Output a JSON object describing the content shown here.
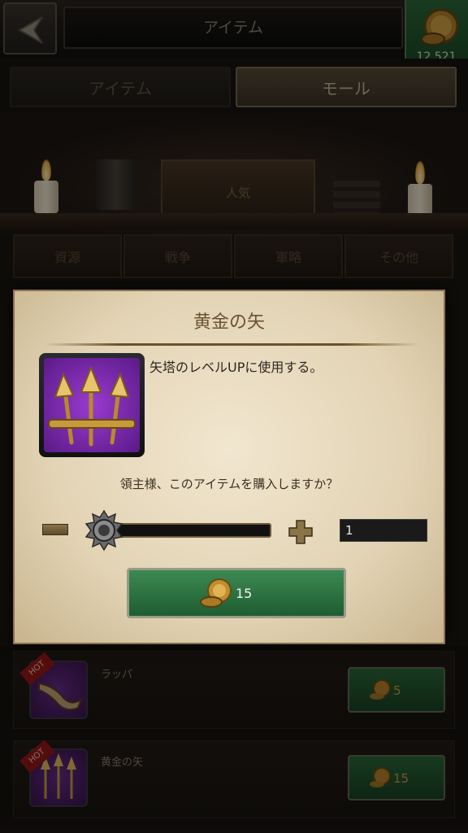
{
  "header": {
    "title": "アイテム",
    "currency_amount": "12,521"
  },
  "tabs": [
    {
      "label": "アイテム",
      "selected": false
    },
    {
      "label": "モール",
      "selected": true
    }
  ],
  "shelf": {
    "drawer_label": "人気"
  },
  "categories": [
    "資源",
    "戦争",
    "軍略",
    "その他"
  ],
  "dialog": {
    "title": "黄金の矢",
    "description": "矢塔のレベルUPに使用する。",
    "question": "領主様、このアイテムを購入しますか？",
    "quantity": "1",
    "price": "15"
  },
  "list": [
    {
      "badge": "HOT",
      "name": "ラッパ",
      "price": "5"
    },
    {
      "badge": "HOT",
      "name": "黄金の矢",
      "price": "15"
    }
  ],
  "colors": {
    "accent_green": "#2c6a3a",
    "parchment": "#e9dcc0",
    "gold": "#c8a050"
  }
}
